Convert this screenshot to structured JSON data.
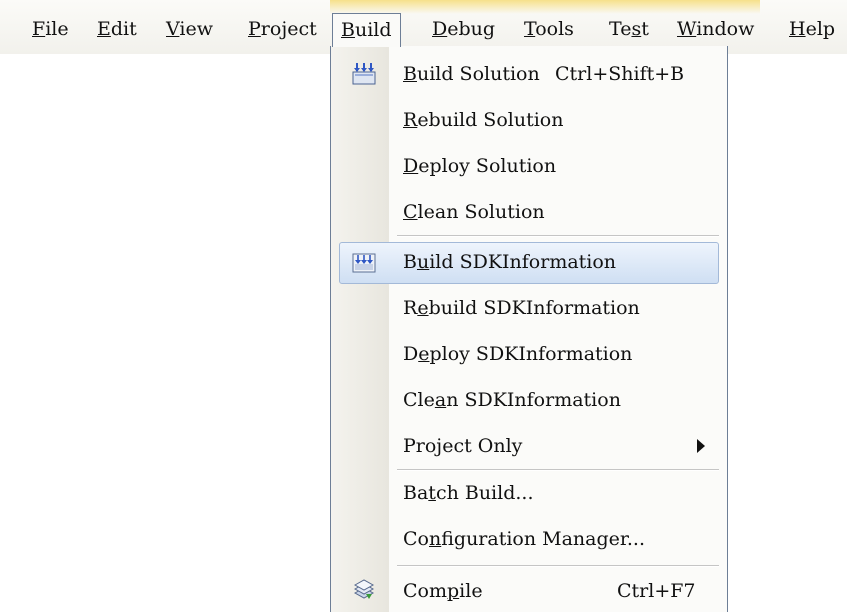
{
  "menubar": {
    "items": [
      {
        "label": "File",
        "accel": "F"
      },
      {
        "label": "Edit",
        "accel": "E"
      },
      {
        "label": "View",
        "accel": "V"
      },
      {
        "label": "Project",
        "accel": "P"
      },
      {
        "label": "Build",
        "accel": "B",
        "active": true
      },
      {
        "label": "Debug",
        "accel": "D"
      },
      {
        "label": "Tools",
        "accel": "T"
      },
      {
        "label": "Test",
        "accel": "s"
      },
      {
        "label": "Window",
        "accel": "W"
      },
      {
        "label": "Help",
        "accel": "H"
      }
    ]
  },
  "build_menu": {
    "items": [
      {
        "label": "Build Solution",
        "shortcut": "Ctrl+Shift+B",
        "accel_index": 0,
        "icon": "build-solution-icon"
      },
      {
        "label": "Rebuild Solution",
        "accel_index": 0
      },
      {
        "label": "Deploy Solution",
        "accel_index": 0
      },
      {
        "label": "Clean Solution",
        "accel_index": 0
      },
      {
        "label": "Build SDKInformation",
        "accel_index": 1,
        "icon": "build-project-icon",
        "highlighted": true
      },
      {
        "label": "Rebuild SDKInformation",
        "accel_index": 1
      },
      {
        "label": "Deploy SDKInformation",
        "accel_index": 1
      },
      {
        "label": "Clean SDKInformation",
        "accel_index": 3
      },
      {
        "label": "Project Only",
        "submenu": true
      },
      {
        "label": "Batch Build...",
        "accel_index": 2
      },
      {
        "label": "Configuration Manager...",
        "accel_index": 2
      },
      {
        "label": "Compile",
        "shortcut": "Ctrl+F7",
        "accel_index": 3,
        "icon": "compile-icon"
      }
    ]
  },
  "colors": {
    "highlight_border": "#a3b9d8",
    "highlight_fill": "#cfdff3",
    "menu_border": "#6d7e96"
  }
}
